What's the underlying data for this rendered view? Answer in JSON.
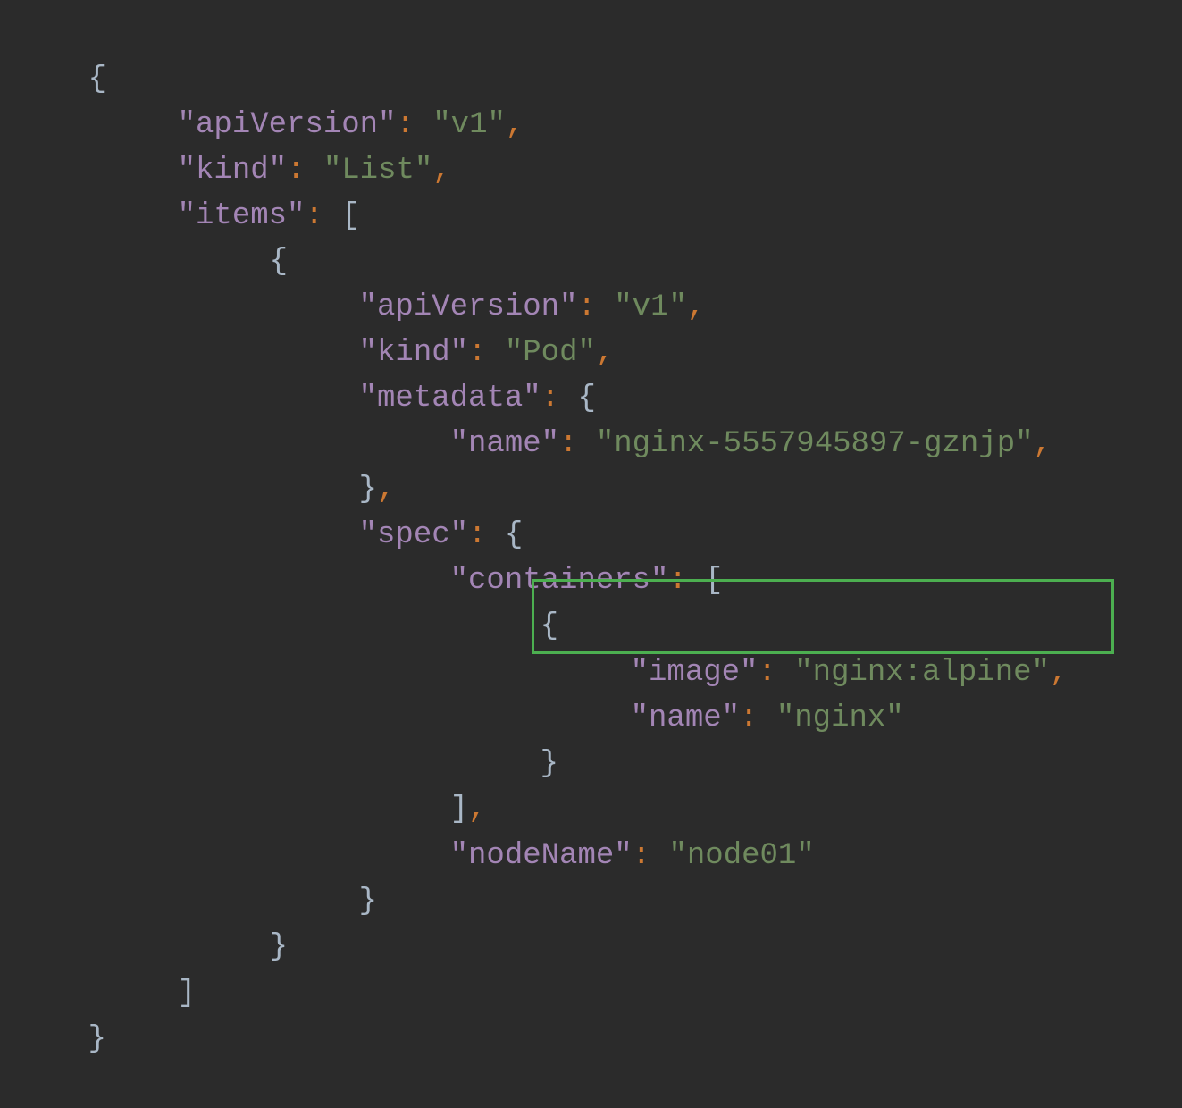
{
  "editor": {
    "lines": [
      {
        "brace": "{"
      },
      {
        "key": "\"apiVersion\"",
        "colon": ":",
        "value": "\"v1\"",
        "comma": ","
      },
      {
        "key": "\"kind\"",
        "colon": ":",
        "value": "\"List\"",
        "comma": ","
      },
      {
        "key": "\"items\"",
        "colon": ":",
        "open": "["
      },
      {
        "brace": "{"
      },
      {
        "key": "\"apiVersion\"",
        "colon": ":",
        "value": "\"v1\"",
        "comma": ","
      },
      {
        "key": "\"kind\"",
        "colon": ":",
        "value": "\"Pod\"",
        "comma": ","
      },
      {
        "key": "\"metadata\"",
        "colon": ":",
        "open": "{"
      },
      {
        "key": "\"name\"",
        "colon": ":",
        "value": "\"nginx-5557945897-gznjp\"",
        "comma": ","
      },
      {
        "brace": "}",
        "comma": ","
      },
      {
        "key": "\"spec\"",
        "colon": ":",
        "open": "{"
      },
      {
        "key": "\"containers\"",
        "colon": ":",
        "open": "["
      },
      {
        "brace": "{"
      },
      {
        "key": "\"image\"",
        "colon": ":",
        "value": "\"nginx:alpine\"",
        "comma": ","
      },
      {
        "key": "\"name\"",
        "colon": ":",
        "value": "\"nginx\""
      },
      {
        "brace": "}"
      },
      {
        "brace": "]",
        "comma": ","
      },
      {
        "key": "\"nodeName\"",
        "colon": ":",
        "value": "\"node01\""
      },
      {
        "brace": "}"
      },
      {
        "brace": "}"
      },
      {
        "brace": "]"
      },
      {
        "brace": "}"
      }
    ]
  },
  "colors": {
    "background": "#2b2b2b",
    "key": "#a385b5",
    "string": "#6f8a5e",
    "punctuation": "#cc7832",
    "brace": "#a9b7c6",
    "highlight_border": "#4caf50"
  }
}
